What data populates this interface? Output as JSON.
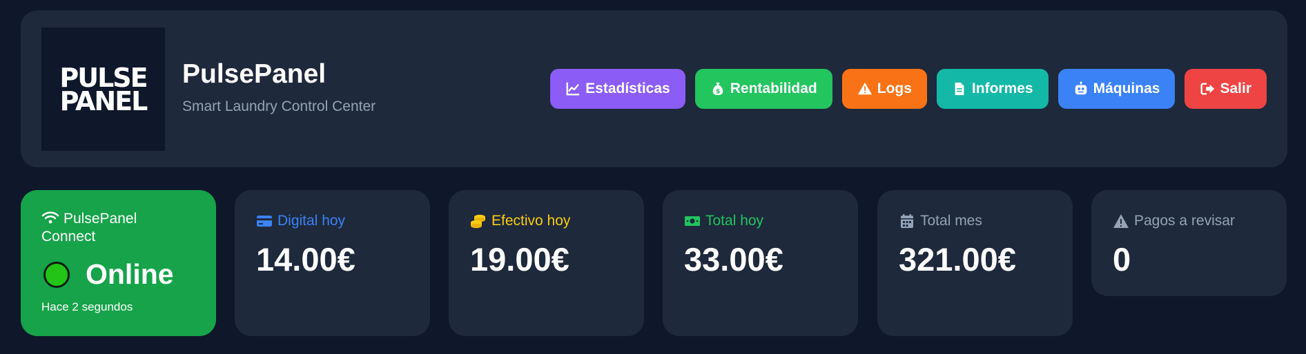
{
  "header": {
    "logo_line1": "PULSE",
    "logo_line2": "PANEL",
    "title": "PulsePanel",
    "subtitle": "Smart Laundry Control Center"
  },
  "nav": [
    {
      "label": "Estadísticas",
      "icon": "chart-line-icon",
      "color": "#8b5cf6"
    },
    {
      "label": "Rentabilidad",
      "icon": "money-bag-icon",
      "color": "#22c55e"
    },
    {
      "label": "Logs",
      "icon": "warning-icon",
      "color": "#f97316"
    },
    {
      "label": "Informes",
      "icon": "document-icon",
      "color": "#14b8a6"
    },
    {
      "label": "Máquinas",
      "icon": "robot-icon",
      "color": "#3b82f6"
    },
    {
      "label": "Salir",
      "icon": "logout-icon",
      "color": "#ef4444"
    }
  ],
  "connection": {
    "label": "PulsePanel Connect",
    "status": "Online",
    "last_seen": "Hace 2 segundos",
    "color": "#16a34a",
    "icon": "wifi-icon"
  },
  "stats": [
    {
      "label": "Digital hoy",
      "value": "14.00€",
      "icon": "credit-card-icon",
      "color": "#3b82f6"
    },
    {
      "label": "Efectivo hoy",
      "value": "19.00€",
      "icon": "coins-icon",
      "color": "#facc15"
    },
    {
      "label": "Total hoy",
      "value": "33.00€",
      "icon": "banknote-icon",
      "color": "#22c55e"
    },
    {
      "label": "Total mes",
      "value": "321.00€",
      "icon": "calendar-icon",
      "color": "#94a3b8"
    },
    {
      "label": "Pagos a revisar",
      "value": "0",
      "icon": "warning-icon",
      "color": "#94a3b8"
    }
  ]
}
